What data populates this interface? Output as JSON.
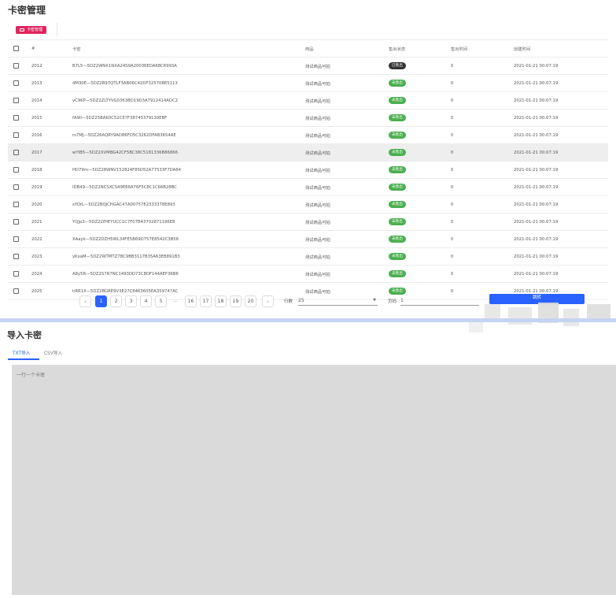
{
  "page": {
    "title": "卡密管理"
  },
  "tag_button": {
    "label": "卡密管理"
  },
  "table": {
    "headers": [
      "#",
      "卡密",
      "商品",
      "售出状态",
      "售出时间",
      "创建时间"
    ],
    "rows": [
      {
        "id": "2012",
        "code": "B7L5—5DZ2WNX1NXA24S9A20036EDA68C6993A",
        "product": "测试商品可拍",
        "status": "已售出",
        "status_type": "dark",
        "sold": "0",
        "created": "2021-01-21 00:07:19"
      },
      {
        "id": "2013",
        "code": "4M30E—5DZ2B97QTLF3AB06C42DF32570BE5113",
        "product": "测试商品可拍",
        "status": "未售出",
        "status_type": "green",
        "sold": "0",
        "created": "2021-01-21 00:07:19"
      },
      {
        "id": "2014",
        "code": "vC9KP—5DZ2ZLTYVG0363BD19D3A7912414ADC2",
        "product": "测试商品可拍",
        "status": "未售出",
        "status_type": "green",
        "sold": "0",
        "created": "2021-01-21 00:07:19"
      },
      {
        "id": "2015",
        "code": "fA9II—5DZ25BAK0C52CE7F38745379130EBF",
        "product": "测试商品可拍",
        "status": "未售出",
        "status_type": "green",
        "sold": "0",
        "created": "2021-01-21 00:07:19"
      },
      {
        "id": "2016",
        "code": "rs7MJ—5DZ26AQRY9AD86FD5C3262DFAB3654AE",
        "product": "测试商品可拍",
        "status": "未售出",
        "status_type": "green",
        "sold": "0",
        "created": "2021-01-21 00:07:19"
      },
      {
        "id": "2017",
        "code": "wYIB5—5DZ2XVMBG42CF5BC38C5181336B86866",
        "product": "测试商品可拍",
        "status": "未售出",
        "status_type": "green",
        "sold": "0",
        "created": "2021-01-21 00:07:19",
        "highlight": true
      },
      {
        "id": "2018",
        "code": "HD79m—5DZ28WNV152824F85D52A77533F7DA64",
        "product": "测试商品可拍",
        "status": "未售出",
        "status_type": "green",
        "sold": "0",
        "created": "2021-01-21 00:07:19"
      },
      {
        "id": "2019",
        "code": "IDB49—5DZ2NCSXCS49E88A76F5C8C1C66B28BC",
        "product": "测试商品可拍",
        "status": "未售出",
        "status_type": "green",
        "sold": "0",
        "created": "2021-01-21 00:07:19"
      },
      {
        "id": "2020",
        "code": "sYOrL—5DZ2BQJCHGAC47A00757E2333378E893",
        "product": "测试商品可拍",
        "status": "未售出",
        "status_type": "green",
        "sold": "0",
        "created": "2021-01-21 00:07:19"
      },
      {
        "id": "2021",
        "code": "YQJp3—5DZ2LYHEYUCC1C7F07B43702871196E8",
        "product": "测试商品可拍",
        "status": "未售出",
        "status_type": "green",
        "sold": "0",
        "created": "2021-01-21 00:07:19"
      },
      {
        "id": "2022",
        "code": "XAayk—5DZ2DZH5WL34FE5B69D757E8542C3B58",
        "product": "测试商品可拍",
        "status": "未售出",
        "status_type": "green",
        "sold": "0",
        "created": "2021-01-21 00:07:19"
      },
      {
        "id": "2023",
        "code": "yKxaM—5DZ2WTMTZ7BC9BB3117B35A63EB891B3",
        "product": "测试商品可拍",
        "status": "未售出",
        "status_type": "green",
        "sold": "0",
        "created": "2021-01-21 00:07:19"
      },
      {
        "id": "2024",
        "code": "A8y5R—5DZ2S7R7NC1493DD73C8DF144AEF36B6",
        "product": "测试商品可拍",
        "status": "未售出",
        "status_type": "green",
        "sold": "0",
        "created": "2021-01-21 00:07:19"
      },
      {
        "id": "2025",
        "code": "hRR1X—5DZ2BGRE9V3E27C6463605EA359747AC",
        "product": "测试商品可拍",
        "status": "未售出",
        "status_type": "green",
        "sold": "0",
        "created": "2021-01-21 00:07:19"
      }
    ]
  },
  "pagination": {
    "prev": "‹",
    "next": "›",
    "pages_left": [
      "1",
      "2",
      "3",
      "4",
      "5"
    ],
    "ellipsis": "...",
    "pages_right": [
      "16",
      "17",
      "18",
      "19",
      "20"
    ],
    "current": "1",
    "rows_label": "行数",
    "rows_value": "25",
    "page_label": "页码",
    "page_value": "1",
    "go_label": "跳转"
  },
  "import": {
    "title": "导入卡密",
    "tabs": [
      "TXT导入",
      "CSV导入"
    ],
    "active_tab": 0,
    "textarea_placeholder": "一行一个卡密"
  },
  "colors": {
    "accent": "#2962ff",
    "tag": "#e0245e",
    "green": "#4caf50",
    "dark": "#333333"
  }
}
